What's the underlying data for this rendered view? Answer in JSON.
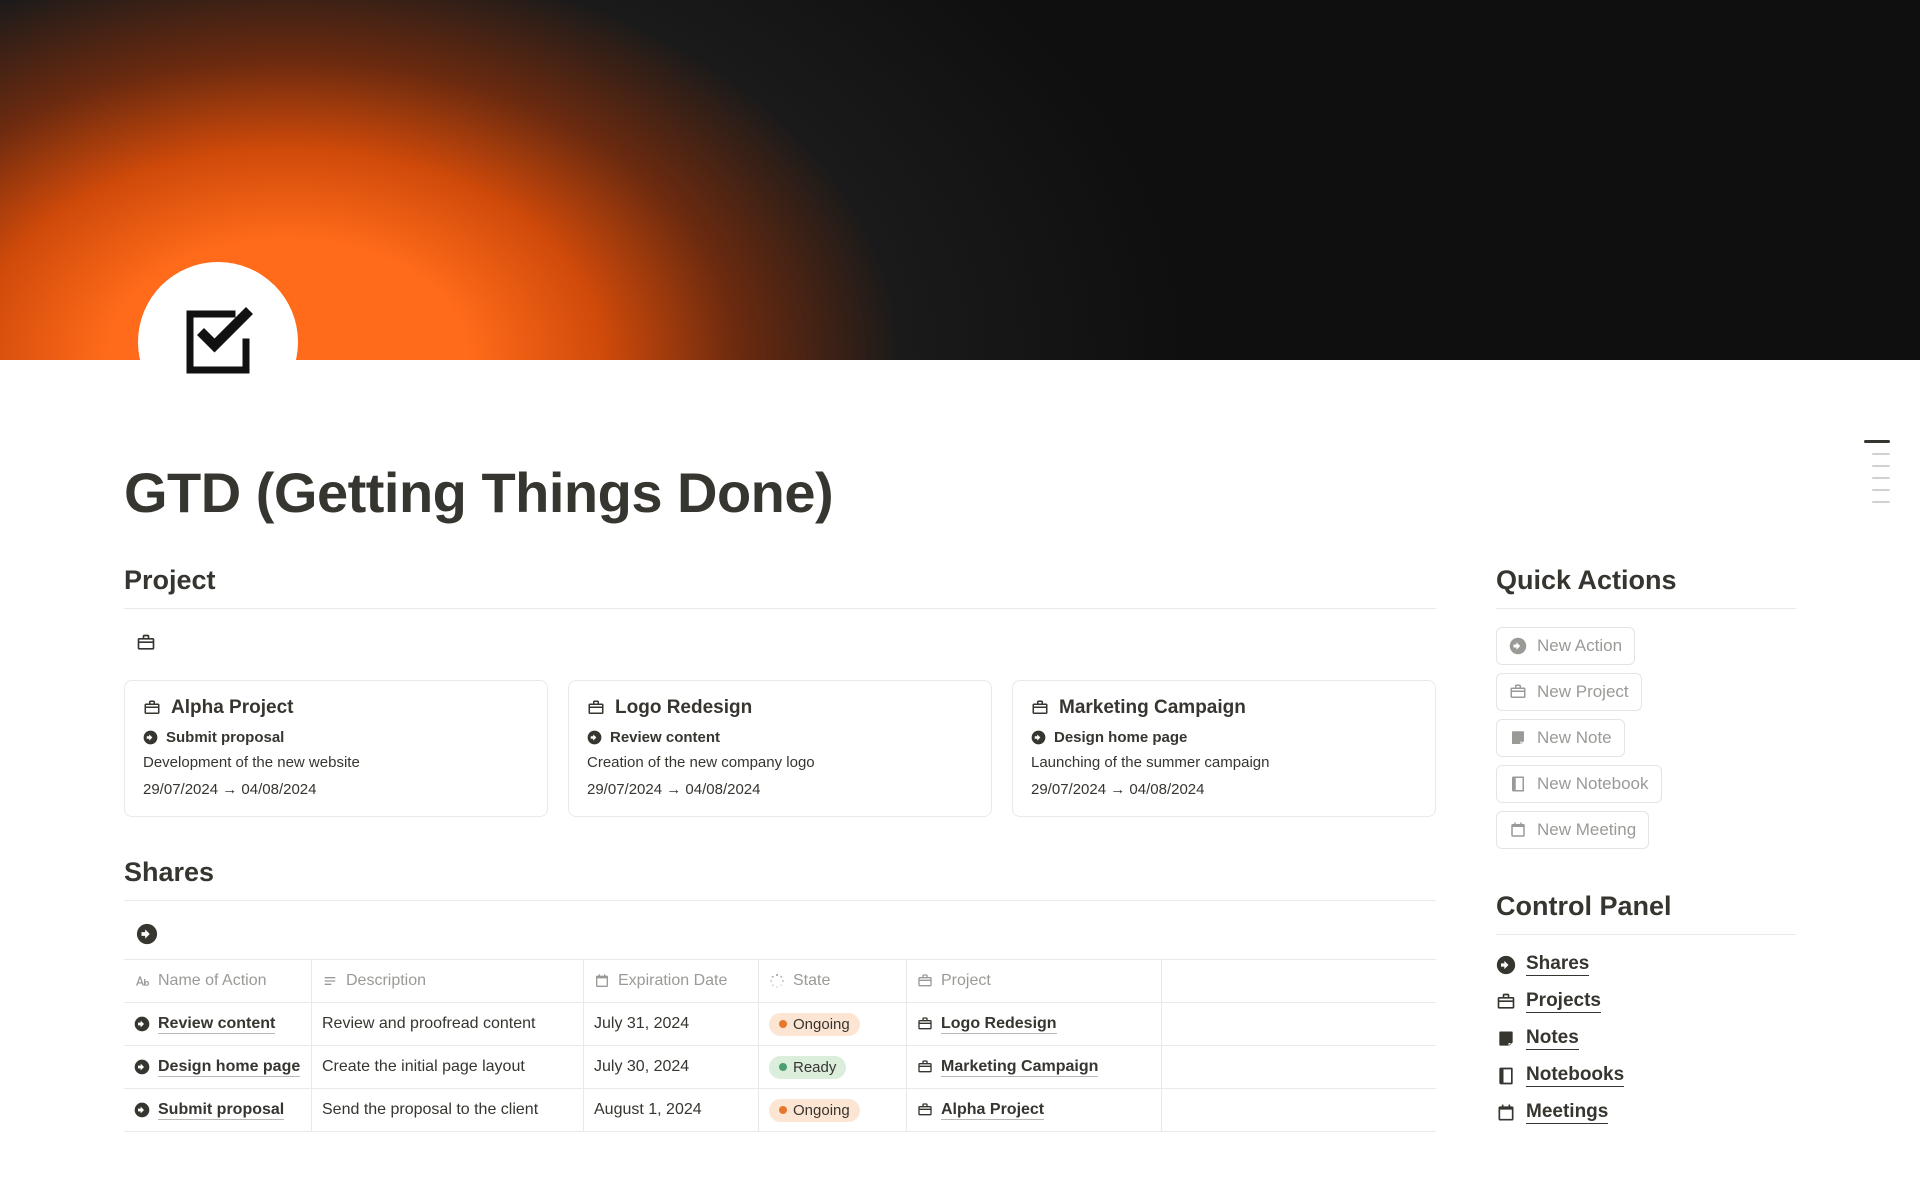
{
  "page": {
    "title": "GTD (Getting Things Done)"
  },
  "sections": {
    "project": "Project",
    "shares": "Shares",
    "quick_actions": "Quick Actions",
    "control_panel": "Control Panel"
  },
  "projects": [
    {
      "name": "Alpha Project",
      "action": "Submit proposal",
      "desc": "Development of the new website",
      "date": "29/07/2024 → 04/08/2024"
    },
    {
      "name": "Logo Redesign",
      "action": "Review content",
      "desc": "Creation of the new company logo",
      "date": "29/07/2024 → 04/08/2024"
    },
    {
      "name": "Marketing Campaign",
      "action": "Design home page",
      "desc": "Launching of the summer campaign",
      "date": "29/07/2024 → 04/08/2024"
    }
  ],
  "shares": {
    "columns": {
      "name": "Name of Action",
      "desc": "Description",
      "exp": "Expiration Date",
      "state": "State",
      "project": "Project"
    },
    "rows": [
      {
        "name": "Review content",
        "desc": "Review and proofread content",
        "exp": "July 31, 2024",
        "state": "Ongoing",
        "state_class": "ongoing",
        "project": "Logo Redesign"
      },
      {
        "name": "Design home page",
        "desc": "Create the initial page layout",
        "exp": "July 30, 2024",
        "state": "Ready",
        "state_class": "ready",
        "project": "Marketing Campaign"
      },
      {
        "name": "Submit proposal",
        "desc": "Send the proposal to the client",
        "exp": "August 1, 2024",
        "state": "Ongoing",
        "state_class": "ongoing",
        "project": "Alpha Project"
      }
    ]
  },
  "quick_actions": [
    {
      "label": "New Action",
      "icon": "arrow"
    },
    {
      "label": "New Project",
      "icon": "briefcase"
    },
    {
      "label": "New Note",
      "icon": "note"
    },
    {
      "label": "New Notebook",
      "icon": "notebook"
    },
    {
      "label": "New Meeting",
      "icon": "calendar"
    }
  ],
  "control_panel": [
    {
      "label": "Shares",
      "icon": "arrow"
    },
    {
      "label": "Projects",
      "icon": "briefcase"
    },
    {
      "label": "Notes",
      "icon": "note"
    },
    {
      "label": "Notebooks",
      "icon": "notebook"
    },
    {
      "label": "Meetings",
      "icon": "calendar"
    }
  ]
}
